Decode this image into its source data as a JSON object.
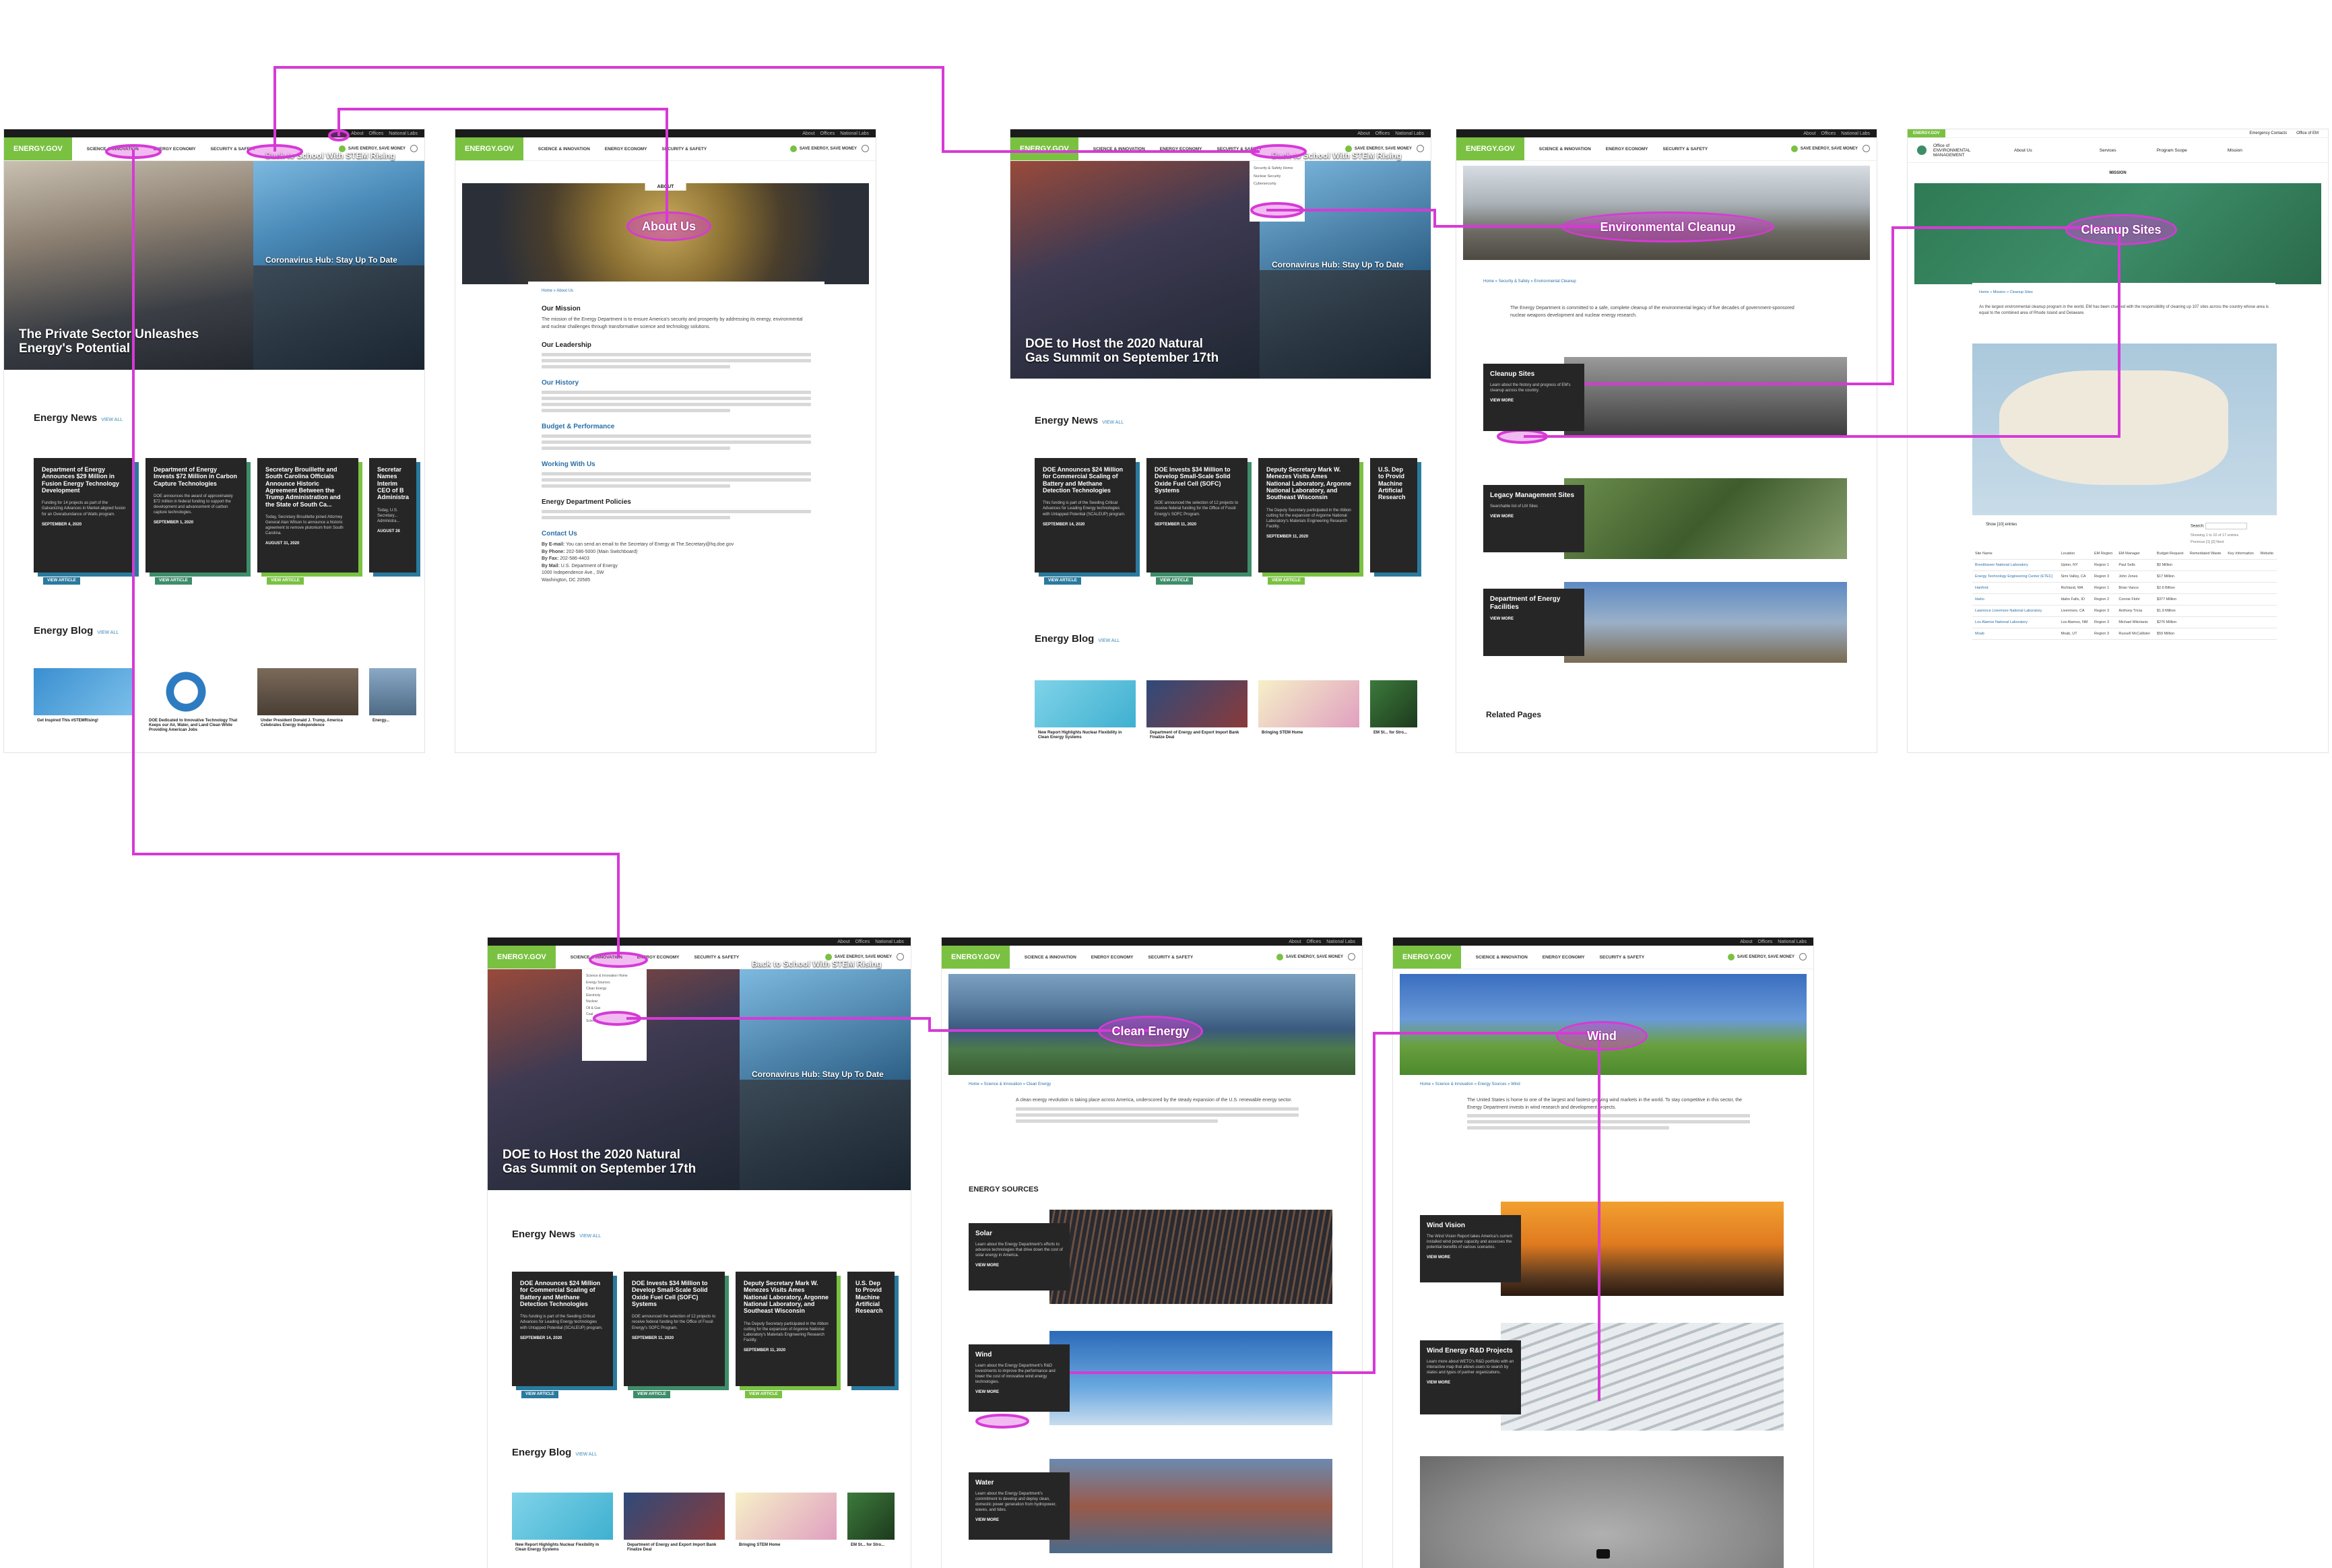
{
  "site": {
    "logo": "ENERGY.GOV",
    "util_links": [
      "f",
      "t",
      "▶",
      "in",
      "◎",
      "About",
      "Offices",
      "National Labs"
    ],
    "nav": [
      "SCIENCE & INNOVATION",
      "ENERGY ECONOMY",
      "SECURITY & SAFETY"
    ],
    "save_label": "SAVE ENERGY, SAVE MONEY"
  },
  "home": {
    "hero_main": "The Private Sector Unleashes Energy's Potential",
    "hero_tile1": "Back to School With STEM Rising",
    "hero_tile2": "Coronavirus Hub: Stay Up To Date",
    "news_title": "Energy News",
    "view_all": "VIEW ALL",
    "view_article": "VIEW ARTICLE",
    "news": [
      {
        "title": "Department of Energy Announces $29 Million in Fusion Energy Technology Development",
        "body": "Funding for 14 projects as part of the Galvanizing Advances in Market-aligned fusion for an Overabundance of Watts program.",
        "date": "SEPTEMBER 4, 2020"
      },
      {
        "title": "Department of Energy Invests $72 Million in Carbon Capture Technologies",
        "body": "DOE announces the award of approximately $72 million in federal funding to support the development and advancement of carbon capture technologies.",
        "date": "SEPTEMBER 1, 2020"
      },
      {
        "title": "Secretary Brouillette and South Carolina Officials Announce Historic Agreement Between the Trump Administration and the State of South Ca...",
        "body": "Today, Secretary Brouillette joined Attorney General Alan Wilson to announce a historic agreement to remove plutonium from South Carolina.",
        "date": "AUGUST 31, 2020"
      },
      {
        "title": "Secretar Names Interim CEO of B Administra",
        "body": "Today, U.S. Secretary... Administra...",
        "date": "AUGUST 28"
      }
    ],
    "blog_title": "Energy Blog",
    "blog": [
      {
        "cap": "Get Inspired This #STEMRising!"
      },
      {
        "cap": "DOE Dedicated to Innovative Technology That Keeps our Air, Water, and Land Clean While Providing American Jobs"
      },
      {
        "cap": "Under President Donald J. Trump, America Celebrates Energy Independence"
      },
      {
        "cap": "Energy..."
      }
    ]
  },
  "about": {
    "banner_label": "ABOUT",
    "breadcrumb": "Home » About Us",
    "h_mission": "Our Mission",
    "p_mission": "The mission of the Energy Department is to ensure America's security and prosperity by addressing its energy, environmental and nuclear challenges through transformative science and technology solutions.",
    "h_leadership": "Our Leadership",
    "h_history": "Our History",
    "h_budget": "Budget & Performance",
    "h_working": "Working With Us",
    "h_policies": "Energy Department Policies",
    "h_contact": "Contact Us",
    "c_email_lbl": "By E-mail:",
    "c_email": "You can send an email to the Secretary of Energy at The.Secretary@hq.doe.gov",
    "c_phone_lbl": "By Phone:",
    "c_phone": "202-586-5000 (Main Switchboard)",
    "c_fax_lbl": "By Fax:",
    "c_fax": "202-586-4403",
    "c_mail_lbl": "By Mail:",
    "c_mail": "U.S. Department of Energy\n1000 Independence Ave., SW\nWashington, DC 20585"
  },
  "home2": {
    "hero_main": "DOE to Host the 2020 Natural Gas Summit on September 17th",
    "hero_tile1": "Back to School With STEM Rising",
    "hero_tile2": "Coronavirus Hub: Stay Up To Date",
    "news": [
      {
        "title": "DOE Announces $24 Million for Commercial Scaling of Battery and Methane Detection Technologies",
        "body": "This funding is part of the Seeding Critical Advances for Leading Energy technologies with Untapped Potential (SCALEUP) program.",
        "date": "SEPTEMBER 14, 2020"
      },
      {
        "title": "DOE Invests $34 Million to Develop Small-Scale Solid Oxide Fuel Cell (SOFC) Systems",
        "body": "DOE announced the selection of 12 projects to receive federal funding for the Office of Fossil Energy's SOFC Program.",
        "date": "SEPTEMBER 11, 2020"
      },
      {
        "title": "Deputy Secretary Mark W. Menezes Visits Ames National Laboratory, Argonne National Laboratory, and Southeast Wisconsin",
        "body": "The Deputy Secretary participated in the ribbon cutting for the expansion of Argonne National Laboratory's Materials Engineering Research Facility.",
        "date": "SEPTEMBER 11, 2020"
      },
      {
        "title": "U.S. Dep to Provid Machine Artificial Research",
        "body": "...",
        "date": ""
      }
    ],
    "blog": [
      {
        "cap": "New Report Highlights Nuclear Flexibility in Clean Energy Systems"
      },
      {
        "cap": "Department of Energy and Export Import Bank Finalize Deal"
      },
      {
        "cap": "Bringing STEM Home"
      },
      {
        "cap": "EM St... for Stro..."
      }
    ],
    "dropdown_sec": [
      "Security & Safety Home",
      "Nuclear Security",
      "Cybersecurity"
    ],
    "dropdown_sci": [
      "Science & Innovation Home",
      "Energy Sources",
      "Clean Energy",
      "Electricity",
      "Nuclear",
      "Oil & Gas",
      "Coal",
      "Science",
      "Infrastructure",
      "Climate Change",
      "Vehicles",
      "Grid"
    ]
  },
  "env": {
    "banner": "Environmental Cleanup",
    "breadcrumb": "Home » Security & Safety » Environmental Cleanup",
    "intro": "The Energy Department is committed to a safe, complete cleanup of the environmental legacy of five decades of government-sponsored nuclear weapons development and nuclear energy research.",
    "tiles": [
      {
        "title": "Cleanup Sites",
        "body": "Learn about the history and progress of EM's cleanup across the country.",
        "more": "VIEW MORE"
      },
      {
        "title": "Legacy Management Sites",
        "body": "Searchable list of LM Sites",
        "more": "VIEW MORE"
      },
      {
        "title": "Department of Energy Facilities",
        "body": "",
        "more": "VIEW MORE"
      }
    ],
    "related": "Related Pages"
  },
  "em": {
    "logo": "ENERGY.GOV",
    "office": "Office of ENVIRONMENTAL MANAGEMENT",
    "nav": [
      "About Us",
      "Services",
      "Program Scope",
      "Mission"
    ],
    "top_links": [
      "Emergency Contacts",
      "Office of EM"
    ],
    "tab": "MISSION",
    "banner": "Cleanup Sites",
    "breadcrumb": "Home » Mission » Cleanup Sites",
    "intro": "As the largest environmental cleanup program in the world, EM has been charged with the responsibility of cleaning up 107 sites across the country whose area is equal to the combined area of Rhode Island and Delaware.",
    "show": "Show",
    "entries": "entries",
    "search": "Search:",
    "showing": "Showing 1 to 10 of 17 entries",
    "prev": "Previous",
    "next": "Next",
    "cols": [
      "Site Name",
      "Location",
      "EM Region",
      "EM Manager",
      "Budget Request",
      "Remediated Waste",
      "Key Information",
      "Website"
    ],
    "rows": [
      [
        "Brookhaven National Laboratory",
        "Upton, NY",
        "Region 1",
        "Paul Sells",
        "$0 Million",
        "",
        "",
        ""
      ],
      [
        "Energy Technology Engineering Center (ETEC)",
        "Simi Valley, CA",
        "Region 3",
        "John Jones",
        "$17 Million",
        "",
        "",
        ""
      ],
      [
        "Hanford",
        "Richland, WA",
        "Region 1",
        "Brian Vance",
        "$2.6 Billion",
        "",
        "",
        ""
      ],
      [
        "Idaho",
        "Idaho Falls, ID",
        "Region 2",
        "Connie Flohr",
        "$377 Million",
        "",
        "",
        ""
      ],
      [
        "Lawrence Livermore National Laboratory",
        "Livermore, CA",
        "Region 3",
        "Anthony Tricia",
        "$1.9 Million",
        "",
        "",
        ""
      ],
      [
        "Los Alamos National Laboratory",
        "Los Alamos, NM",
        "Region 3",
        "Michael Mikolanis",
        "$276 Million",
        "",
        "",
        ""
      ],
      [
        "Moab",
        "Moab, UT",
        "Region 3",
        "Russell McCallister",
        "$59 Million",
        "",
        "",
        ""
      ]
    ]
  },
  "clean": {
    "banner": "Clean Energy",
    "breadcrumb": "Home » Science & Innovation » Clean Energy",
    "intro": "A clean energy revolution is taking place across America, underscored by the steady expansion of the U.S. renewable energy sector.",
    "sources_title": "ENERGY SOURCES",
    "tiles": [
      {
        "title": "Solar",
        "body": "Learn about the Energy Department's efforts to advance technologies that drive down the cost of solar energy in America.",
        "more": "VIEW MORE"
      },
      {
        "title": "Wind",
        "body": "Learn about the Energy Department's R&D investments to improve the performance and lower the cost of innovative wind energy technologies.",
        "more": "VIEW MORE"
      },
      {
        "title": "Water",
        "body": "Learn about the Energy Department's commitment to develop and deploy clean, domestic power generation from hydropower, waves, and tides.",
        "more": "VIEW MORE"
      }
    ]
  },
  "wind": {
    "banner": "Wind",
    "breadcrumb": "Home » Science & Innovation » Energy Sources » Wind",
    "intro": "The United States is home to one of the largest and fastest-growing wind markets in the world. To stay competitive in this sector, the Energy Department invests in wind research and development projects.",
    "tiles": [
      {
        "title": "Wind Vision",
        "body": "The Wind Vision Report takes America's current installed wind power capacity and assesses the potential benefits of various scenarios.",
        "more": "VIEW MORE"
      },
      {
        "title": "Wind Energy R&D Projects",
        "body": "Learn more about WETO's R&D portfolio with an interactive map that allows users to search by states and types of partner organizations.",
        "more": "VIEW MORE"
      }
    ]
  },
  "highlights": {
    "about": "About Us",
    "env": "Environmental Cleanup",
    "cleanup": "Cleanup Sites",
    "clean": "Clean Energy",
    "wind": "Wind"
  },
  "colors": {
    "accent": "#7ac142",
    "flow": "#d63ad6",
    "dark": "#262626",
    "teal": "#2a7a9e"
  }
}
